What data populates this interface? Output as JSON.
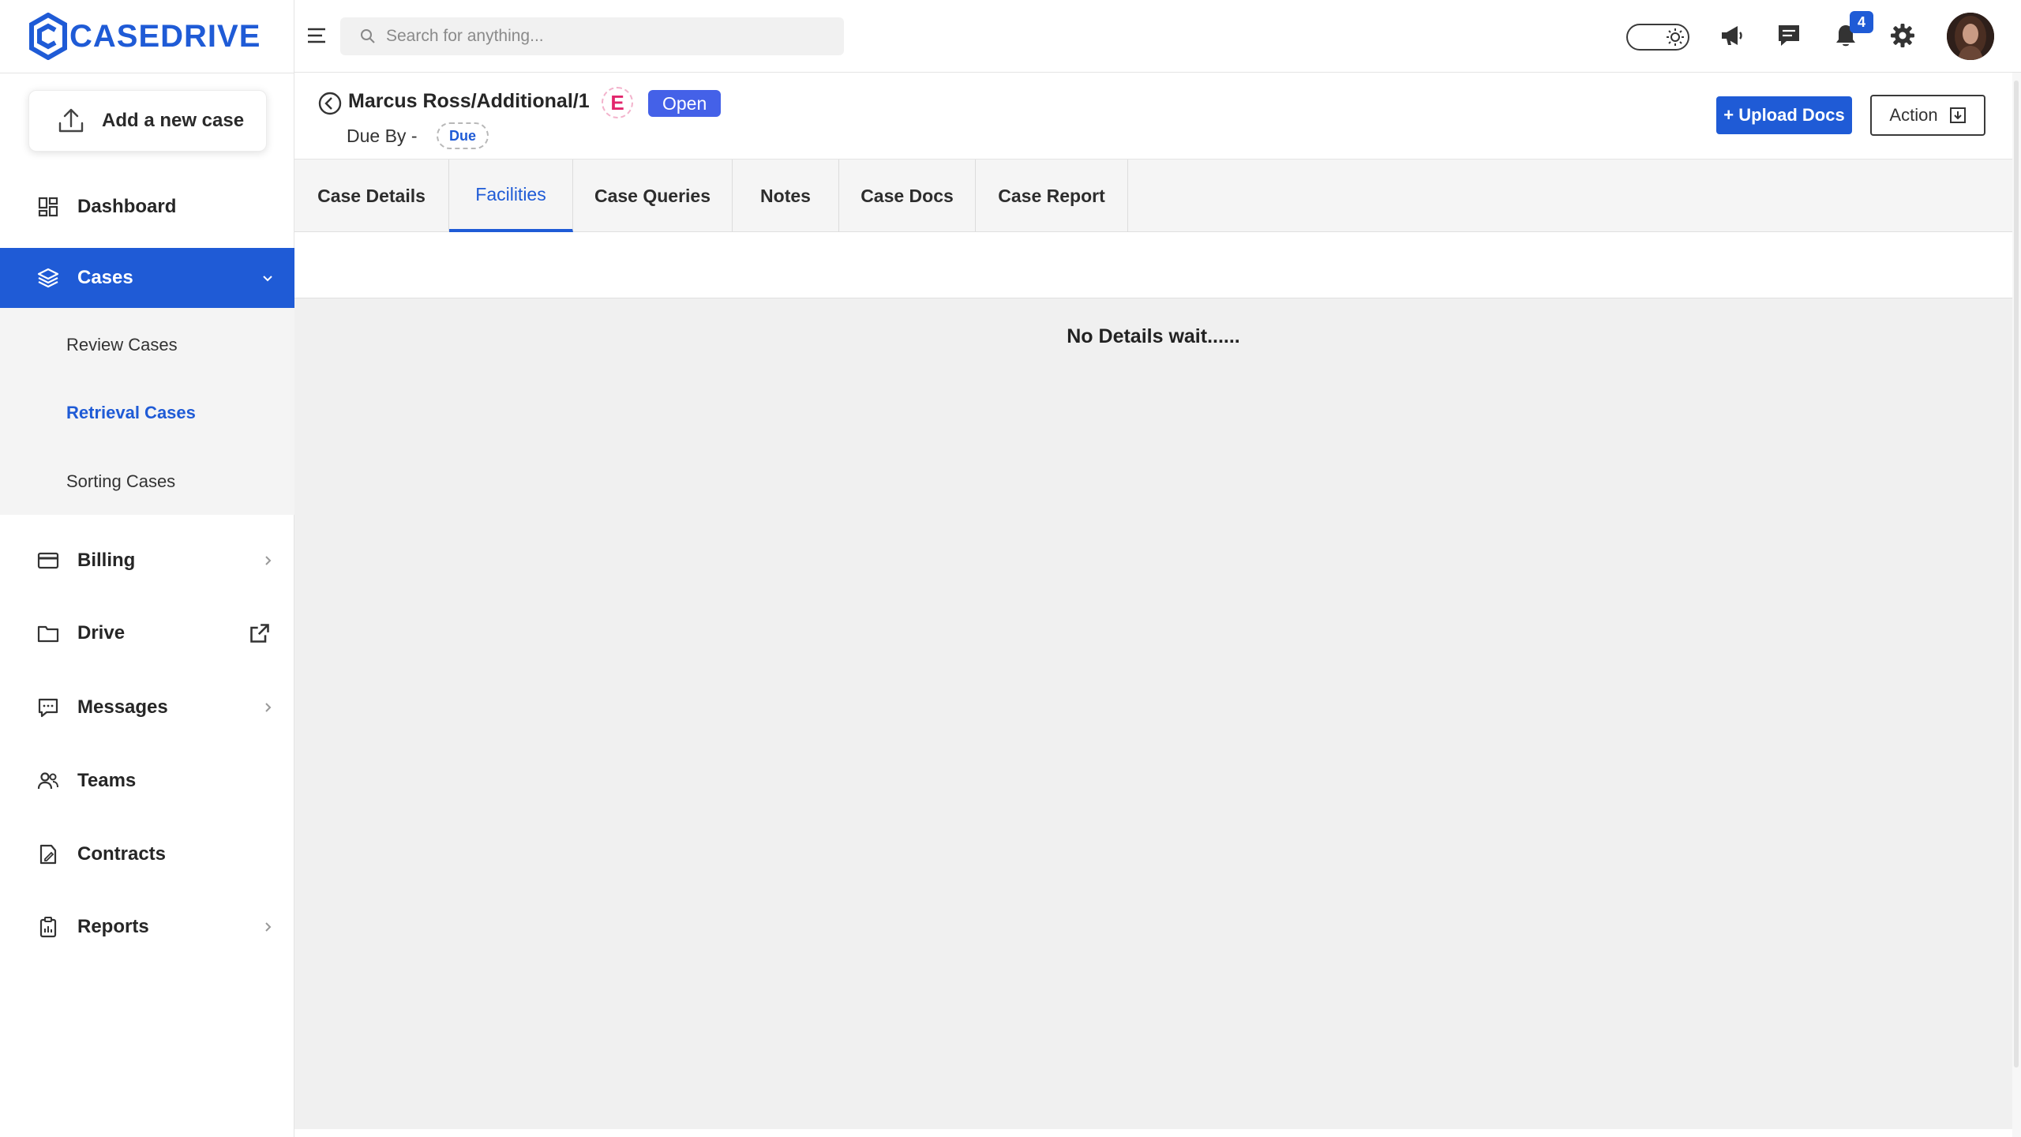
{
  "brand": {
    "name": "CASEDRIVE",
    "color": "#1f5bd6"
  },
  "progress": 0.2,
  "sidebar": {
    "add_case_label": "Add a new case",
    "items": [
      {
        "label": "Dashboard",
        "icon": "dashboard-icon"
      },
      {
        "label": "Cases",
        "icon": "layers-icon",
        "active": true,
        "expanded": true
      },
      {
        "label": "Billing",
        "icon": "credit-card-icon"
      },
      {
        "label": "Drive",
        "icon": "folder-icon"
      },
      {
        "label": "Messages",
        "icon": "message-icon"
      },
      {
        "label": "Teams",
        "icon": "users-icon"
      },
      {
        "label": "Contracts",
        "icon": "contract-icon"
      },
      {
        "label": "Reports",
        "icon": "clipboard-icon"
      }
    ],
    "cases_sub": [
      {
        "label": "Review Cases"
      },
      {
        "label": "Retrieval Cases",
        "active": true
      },
      {
        "label": "Sorting Cases"
      }
    ]
  },
  "header": {
    "search_placeholder": "Search for anything...",
    "notification_count": "4",
    "icons": [
      "theme-toggle-icon",
      "megaphone-icon",
      "chat-icon",
      "bell-icon",
      "gear-icon",
      "avatar"
    ]
  },
  "case": {
    "title": "Marcus Ross/Additional/1",
    "e_badge": "E",
    "status": "Open",
    "due_by_label": "Due By -",
    "due_pill": "Due",
    "upload_label": "+ Upload Docs",
    "action_label": "Action"
  },
  "tabs": [
    {
      "label": "Case Details"
    },
    {
      "label": "Facilities",
      "active": true
    },
    {
      "label": "Case Queries"
    },
    {
      "label": "Notes"
    },
    {
      "label": "Case Docs"
    },
    {
      "label": "Case Report"
    }
  ],
  "empty_message": "No Details wait......",
  "colors": {
    "accent": "#1f5bd6",
    "status_open": "#4461e8",
    "e_badge": "#e2266c"
  }
}
